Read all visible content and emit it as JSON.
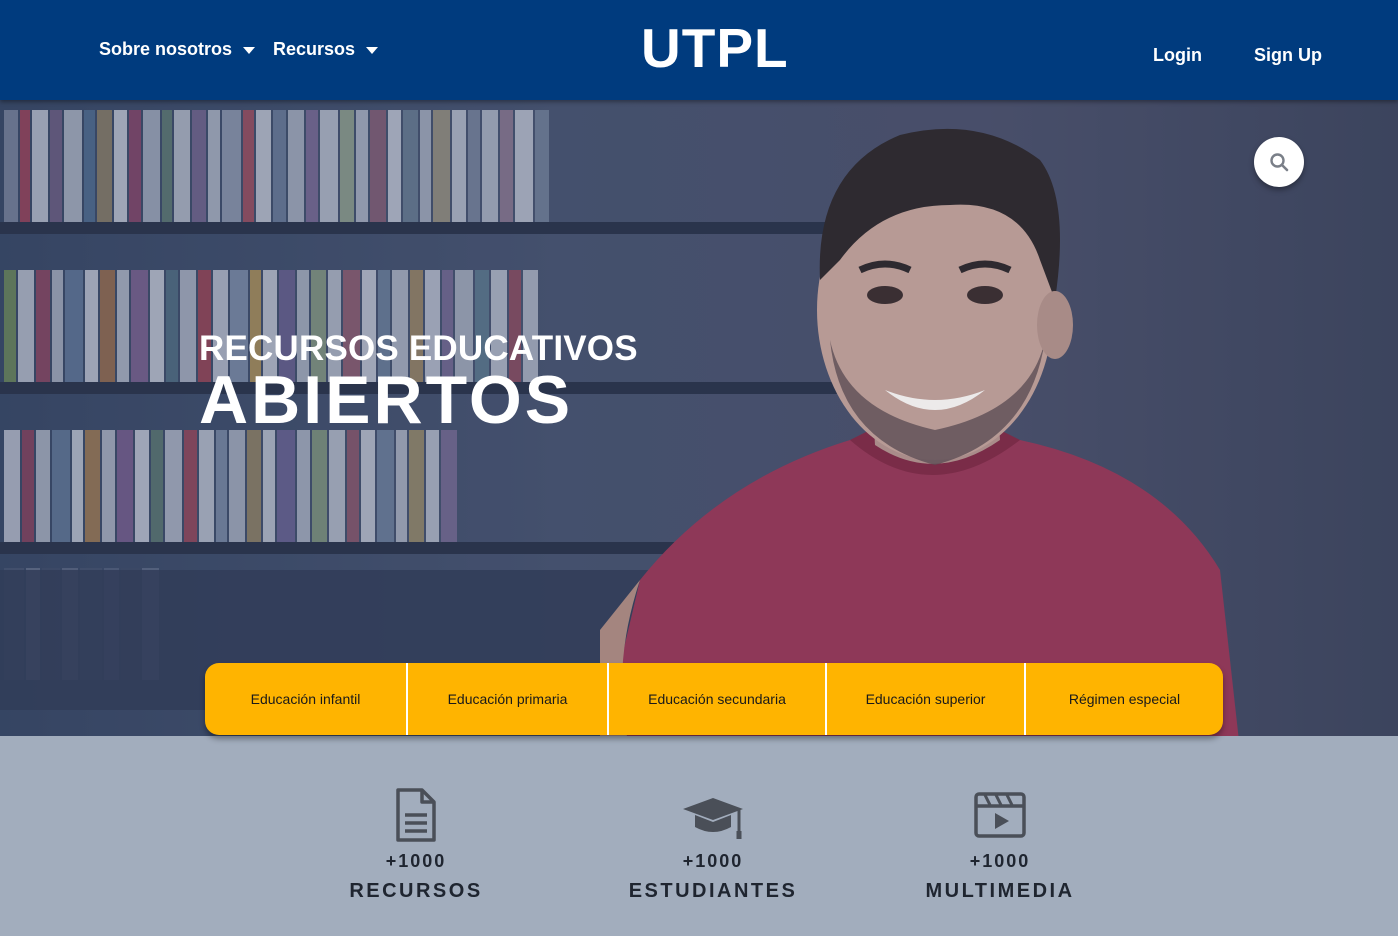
{
  "header": {
    "nav": [
      {
        "label": "Sobre nosotros"
      },
      {
        "label": "Recursos"
      }
    ],
    "logo": "UTPL",
    "login_label": "Login",
    "signup_label": "Sign Up"
  },
  "hero": {
    "subtitle": "RECURSOS EDUCATIVOS",
    "title": "ABIERTOS",
    "search_icon": "search-icon"
  },
  "categories": [
    {
      "label": "Educación infantil"
    },
    {
      "label": "Educación primaria"
    },
    {
      "label": "Educación secundaria"
    },
    {
      "label": "Educación superior"
    },
    {
      "label": "Régimen especial"
    }
  ],
  "stats": [
    {
      "icon": "document-icon",
      "count": "+1000",
      "label": "RECURSOS"
    },
    {
      "icon": "graduation-cap-icon",
      "count": "+1000",
      "label": "ESTUDIANTES"
    },
    {
      "icon": "video-film-icon",
      "count": "+1000",
      "label": "MULTIMEDIA"
    }
  ],
  "colors": {
    "header_bg": "#003b7e",
    "accent": "#ffb400",
    "stats_bg": "#a2adbd",
    "text_dark": "#1f2530"
  }
}
